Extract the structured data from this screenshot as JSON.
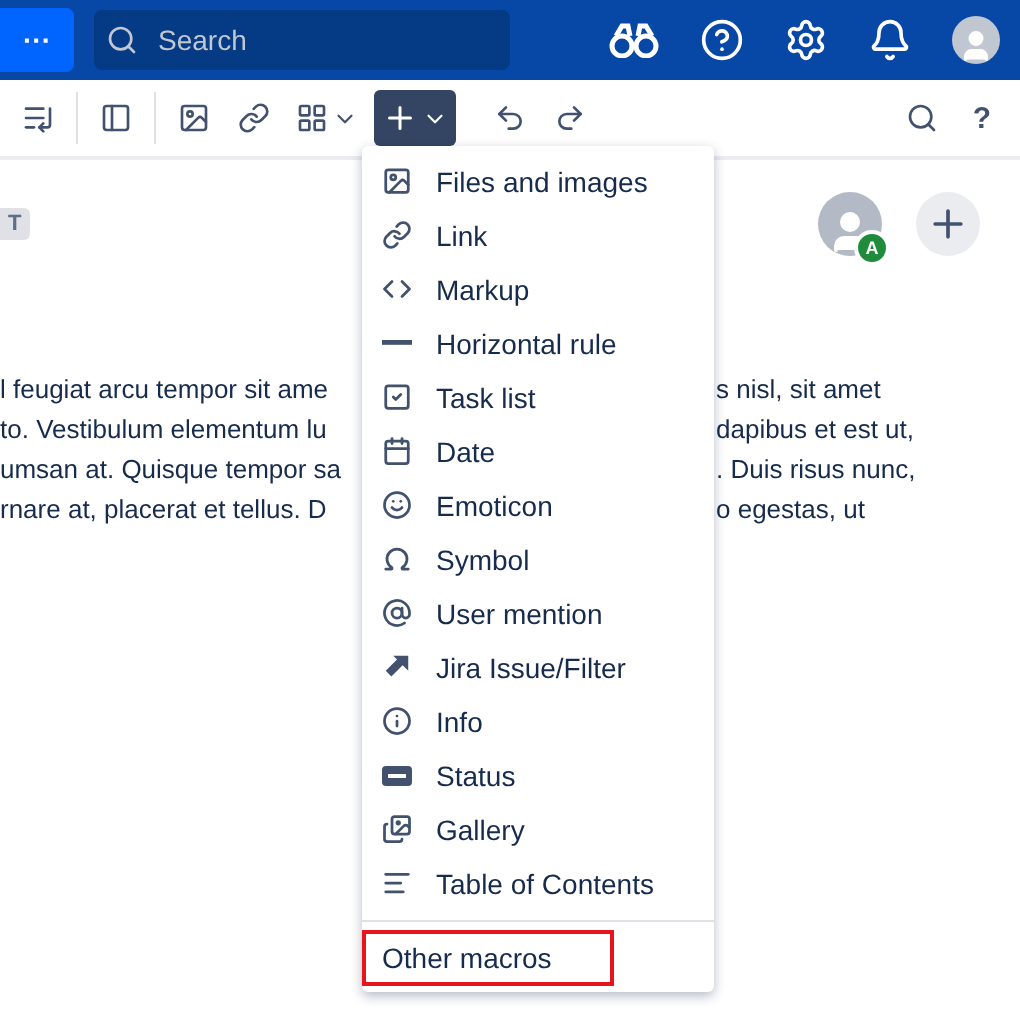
{
  "top_bar": {
    "menu_button": "···",
    "search": {
      "placeholder": "Search"
    }
  },
  "toolbar": {
    "insert_expanded": true,
    "help": "?"
  },
  "page": {
    "tag": "T",
    "avatar_badge": "A",
    "lines": [
      {
        "left": "l feugiat arcu tempor sit ame",
        "right": "s nisl, sit amet"
      },
      {
        "left": "to. Vestibulum elementum lu",
        "right": "dapibus et est ut,"
      },
      {
        "left": "umsan at. Quisque tempor sa",
        "right": ". Duis risus nunc,"
      },
      {
        "left": "rnare at, placerat et tellus. D",
        "right": "o egestas, ut"
      }
    ]
  },
  "insert_menu": {
    "items": [
      {
        "kind": "image",
        "label": "Files and images"
      },
      {
        "kind": "link",
        "label": "Link"
      },
      {
        "kind": "code",
        "label": "Markup"
      },
      {
        "kind": "rule",
        "label": "Horizontal rule"
      },
      {
        "kind": "task",
        "label": "Task list"
      },
      {
        "kind": "date",
        "label": "Date"
      },
      {
        "kind": "emoticon",
        "label": "Emoticon"
      },
      {
        "kind": "symbol",
        "label": "Symbol"
      },
      {
        "kind": "mention",
        "label": "User mention"
      },
      {
        "kind": "jira",
        "label": "Jira Issue/Filter"
      },
      {
        "kind": "info",
        "label": "Info"
      },
      {
        "kind": "status",
        "label": "Status"
      },
      {
        "kind": "gallery",
        "label": "Gallery"
      },
      {
        "kind": "toc",
        "label": "Table of Contents"
      }
    ],
    "footer": {
      "label": "Other macros",
      "highlighted": true
    }
  }
}
